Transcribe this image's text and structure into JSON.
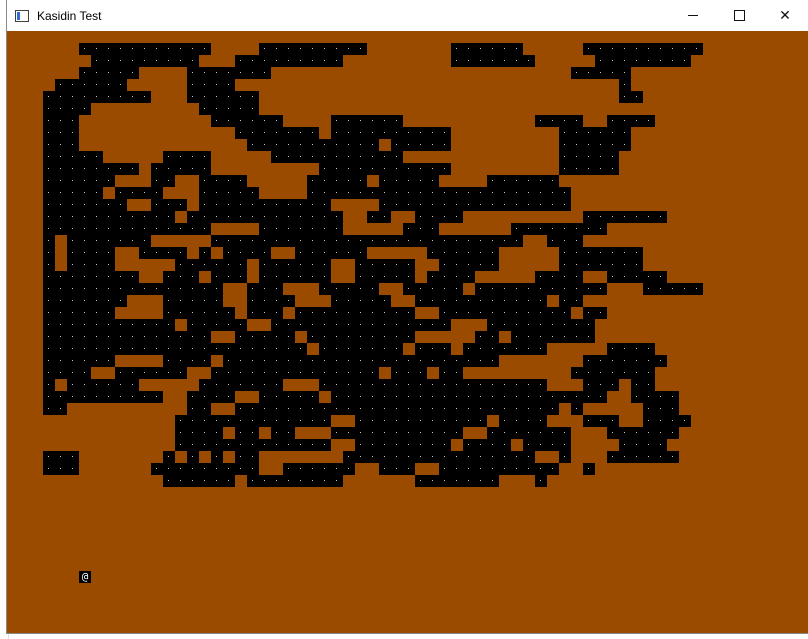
{
  "window": {
    "title": "Kasidin Test",
    "controls": {
      "minimize": "",
      "maximize": "",
      "close": "✕"
    }
  },
  "game": {
    "floor_glyph": ".",
    "player_glyph": "@",
    "colors": {
      "wall": "#9a4b00",
      "floor": "#000000",
      "floor_dot": "#c8c8c8",
      "player": "#ffffff"
    },
    "map_rows": [
      "...###########....#########.......######.....##########.",
      "....#########...#########.........#######.....########..",
      "...#####....#######.........................#####.......",
      ".######.....####................................#.......",
      "#########...######..............................##......",
      "####.........#####.......................................",
      "###...........######....######...........####..####.....",
      "###.............#######.##########.........######.......",
      "###..............###########.#####.........######.......",
      "#####.....####.....###########.............#####........",
      "########.#####.........###########.........#####.......",
      "######...##..####.....#####.#####....######.............",
      "#####.####...#####....######################.............",
      "#######..###.###########....################.............",
      "###########.#############..##..####..........#######......",
      "##############....#######.....###......########..........",
      "#.#######.....##########################..###.........",
      "#.####..####.#.####..######.....######.....#######....",
      "#.####.....######.######..#####..#####.....#######.....",
      "########..###.###.######..#####.####.....####..#####....",
      "###############..###...#####..#####.###########...#####.",
      "#######...#####..####...#####..###########.##.........",
      "######....######.###.##########..###########.##.........",
      "###########.#####..###############...#########.........",
      "##############..#####.#########.....##.#######......",
      "######################.#######.###.#######.....####...",
      "######....####.#######################.......#######...",
      "####..######..##############.###.##.........#######..",
      "#.######.....#######...###################...###.##...",
      "##########..####..#####.#######################..####.",
      "##..........##..###########################.#.....###.",
      "...........#############..###########.####...###..####",
      "...........####.##.##...###########..#######...######.",
      "...........#############..########.####.####....####..",
      "###.......#.#.#.##.......################..#...######..",
      "###......#########..######..###..##########..#.......",
      "..........######.########......#######...#.........."
    ],
    "player_position": {
      "col": 3,
      "row": 45
    }
  }
}
